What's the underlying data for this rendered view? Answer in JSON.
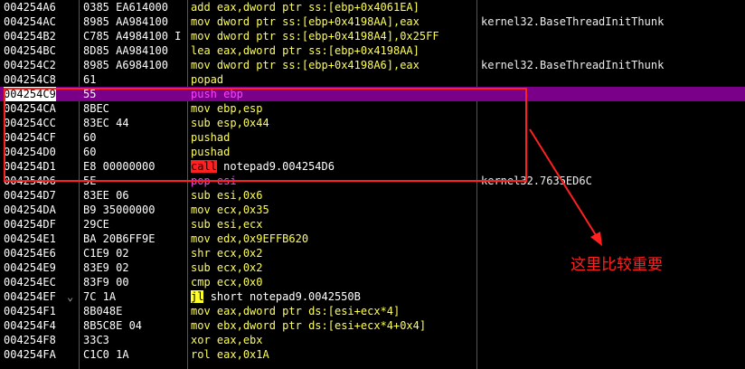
{
  "rows": [
    {
      "addr": "004254A6",
      "hex": "0385 EA614000",
      "mn": "add",
      "ops": "eax,dword ptr ss:[ebp+0x4061EA]",
      "cmt": "",
      "style": "yellow"
    },
    {
      "addr": "004254AC",
      "hex": "8985 AA984100",
      "mn": "mov",
      "ops": "dword ptr ss:[ebp+0x4198AA],eax",
      "cmt": "kernel32.BaseThreadInitThunk",
      "style": "yellow"
    },
    {
      "addr": "004254B2",
      "hex": "C785 A4984100 I",
      "mn": "mov",
      "ops": "dword ptr ss:[ebp+0x4198A4],0x25FF",
      "cmt": "",
      "style": "yellow"
    },
    {
      "addr": "004254BC",
      "hex": "8D85 AA984100",
      "mn": "lea",
      "ops": "eax,dword ptr ss:[ebp+0x4198AA]",
      "cmt": "",
      "style": "yellow"
    },
    {
      "addr": "004254C2",
      "hex": "8985 A6984100",
      "mn": "mov",
      "ops": "dword ptr ss:[ebp+0x4198A6],eax",
      "cmt": "kernel32.BaseThreadInitThunk",
      "style": "yellow"
    },
    {
      "addr": "004254C8",
      "hex": "61",
      "mn": "popad",
      "ops": "",
      "cmt": "",
      "style": "yellow"
    },
    {
      "addr": "004254C9",
      "hex": "55",
      "mn": "push",
      "ops": "ebp",
      "cmt": "",
      "style": "pink",
      "selected": true
    },
    {
      "addr": "004254CA",
      "hex": "8BEC",
      "mn": "mov",
      "ops": "ebp,esp",
      "cmt": "",
      "style": "yellow"
    },
    {
      "addr": "004254CC",
      "hex": "83EC 44",
      "mn": "sub",
      "ops": "esp,0x44",
      "cmt": "",
      "style": "yellow"
    },
    {
      "addr": "004254CF",
      "hex": "60",
      "mn": "pushad",
      "ops": "",
      "cmt": "",
      "style": "yellow"
    },
    {
      "addr": "004254D0",
      "hex": "60",
      "mn": "pushad",
      "ops": "",
      "cmt": "",
      "style": "yellow"
    },
    {
      "addr": "004254D1",
      "hex": "E8 00000000",
      "mn": "call",
      "ops": "notepad9.004254D6",
      "cmt": "",
      "style": "call"
    },
    {
      "addr": "004254D6",
      "hex": "5E",
      "mn": "pop",
      "ops": "esi",
      "cmt": "kernel32.7635ED6C",
      "style": "pink"
    },
    {
      "addr": "004254D7",
      "hex": "83EE 06",
      "mn": "sub",
      "ops": "esi,0x6",
      "cmt": "",
      "style": "yellow"
    },
    {
      "addr": "004254DA",
      "hex": "B9 35000000",
      "mn": "mov",
      "ops": "ecx,0x35",
      "cmt": "",
      "style": "yellow"
    },
    {
      "addr": "004254DF",
      "hex": "29CE",
      "mn": "sub",
      "ops": "esi,ecx",
      "cmt": "",
      "style": "yellow"
    },
    {
      "addr": "004254E1",
      "hex": "BA 20B6FF9E",
      "mn": "mov",
      "ops": "edx,0x9EFFB620",
      "cmt": "",
      "style": "yellow"
    },
    {
      "addr": "004254E6",
      "hex": "C1E9 02",
      "mn": "shr",
      "ops": "ecx,0x2",
      "cmt": "",
      "style": "yellow"
    },
    {
      "addr": "004254E9",
      "hex": "83E9 02",
      "mn": "sub",
      "ops": "ecx,0x2",
      "cmt": "",
      "style": "yellow"
    },
    {
      "addr": "004254EC",
      "hex": "83F9 00",
      "mn": "cmp",
      "ops": "ecx,0x0",
      "cmt": "",
      "style": "yellow"
    },
    {
      "addr": "004254EF",
      "hex": "7C 1A",
      "mn": "jl",
      "ops": "short notepad9.0042550B",
      "cmt": "",
      "style": "jump",
      "mark": "⌄"
    },
    {
      "addr": "004254F1",
      "hex": "8B048E",
      "mn": "mov",
      "ops": "eax,dword ptr ds:[esi+ecx*4]",
      "cmt": "",
      "style": "yellow"
    },
    {
      "addr": "004254F4",
      "hex": "8B5C8E 04",
      "mn": "mov",
      "ops": "ebx,dword ptr ds:[esi+ecx*4+0x4]",
      "cmt": "",
      "style": "yellow"
    },
    {
      "addr": "004254F8",
      "hex": "33C3",
      "mn": "xor",
      "ops": "eax,ebx",
      "cmt": "",
      "style": "yellow"
    },
    {
      "addr": "004254FA",
      "hex": "C1C0 1A",
      "mn": "rol",
      "ops": "eax,0x1A",
      "cmt": "",
      "style": "yellow"
    }
  ],
  "annotation": {
    "text": "这里比较重要",
    "color": "#ff2020"
  },
  "colors": {
    "selection": "#7a008a",
    "mnemonic": "#ffff50",
    "stack_op": "#ff40ff",
    "call_bg": "#ff2020",
    "jump_bg": "#ffff30"
  }
}
